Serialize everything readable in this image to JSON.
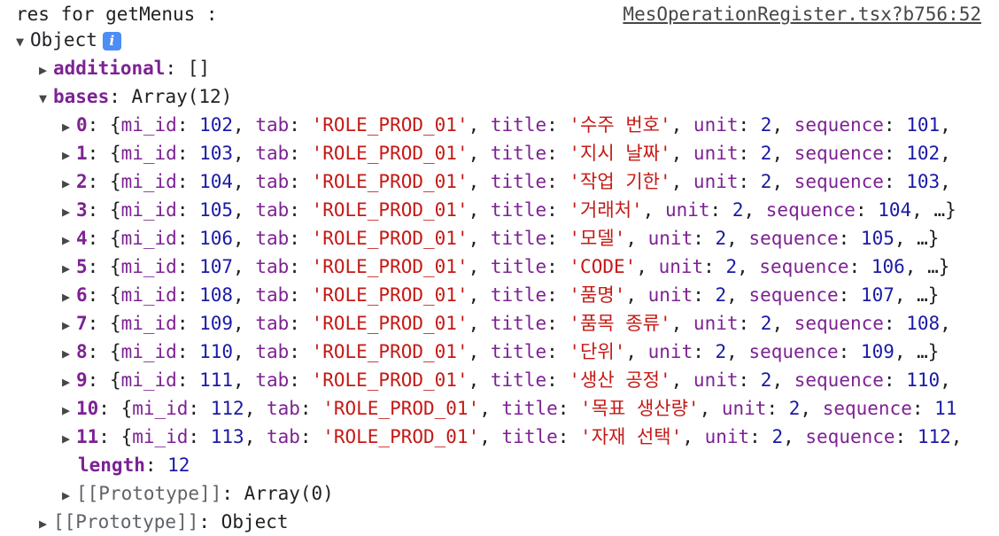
{
  "header": {
    "message": "res for getMenus :",
    "source_link": "MesOperationRegister.tsx?b756:52"
  },
  "root": {
    "label": "Object",
    "info_icon": "i"
  },
  "additional": {
    "key": "additional",
    "value": "[]"
  },
  "bases": {
    "key": "bases",
    "value": "Array(12)",
    "items": [
      {
        "idx": "0",
        "mi_id": "102",
        "tab": "'ROLE_PROD_01'",
        "title": "'수주 번호'",
        "unit": "2",
        "sequence": "101",
        "tail": ","
      },
      {
        "idx": "1",
        "mi_id": "103",
        "tab": "'ROLE_PROD_01'",
        "title": "'지시 날짜'",
        "unit": "2",
        "sequence": "102",
        "tail": ","
      },
      {
        "idx": "2",
        "mi_id": "104",
        "tab": "'ROLE_PROD_01'",
        "title": "'작업 기한'",
        "unit": "2",
        "sequence": "103",
        "tail": ","
      },
      {
        "idx": "3",
        "mi_id": "105",
        "tab": "'ROLE_PROD_01'",
        "title": "'거래처'",
        "unit": "2",
        "sequence": "104",
        "tail": ", …}"
      },
      {
        "idx": "4",
        "mi_id": "106",
        "tab": "'ROLE_PROD_01'",
        "title": "'모델'",
        "unit": "2",
        "sequence": "105",
        "tail": ", …}"
      },
      {
        "idx": "5",
        "mi_id": "107",
        "tab": "'ROLE_PROD_01'",
        "title": "'CODE'",
        "unit": "2",
        "sequence": "106",
        "tail": ", …}"
      },
      {
        "idx": "6",
        "mi_id": "108",
        "tab": "'ROLE_PROD_01'",
        "title": "'품명'",
        "unit": "2",
        "sequence": "107",
        "tail": ", …}"
      },
      {
        "idx": "7",
        "mi_id": "109",
        "tab": "'ROLE_PROD_01'",
        "title": "'품목 종류'",
        "unit": "2",
        "sequence": "108",
        "tail": ","
      },
      {
        "idx": "8",
        "mi_id": "110",
        "tab": "'ROLE_PROD_01'",
        "title": "'단위'",
        "unit": "2",
        "sequence": "109",
        "tail": ", …}"
      },
      {
        "idx": "9",
        "mi_id": "111",
        "tab": "'ROLE_PROD_01'",
        "title": "'생산 공정'",
        "unit": "2",
        "sequence": "110",
        "tail": ","
      },
      {
        "idx": "10",
        "mi_id": "112",
        "tab": "'ROLE_PROD_01'",
        "title": "'목표 생산량'",
        "unit": "2",
        "sequence": "11",
        "tail": ""
      },
      {
        "idx": "11",
        "mi_id": "113",
        "tab": "'ROLE_PROD_01'",
        "title": "'자재 선택'",
        "unit": "2",
        "sequence": "112",
        "tail": ","
      }
    ],
    "length_key": "length",
    "length_value": "12",
    "prototype_key": "[[Prototype]]",
    "prototype_value": "Array(0)"
  },
  "root_prototype": {
    "key": "[[Prototype]]",
    "value": "Object"
  },
  "labels": {
    "mi_id": "mi_id",
    "tab": "tab",
    "title": "title",
    "unit": "unit",
    "sequence": "sequence"
  },
  "icons": {
    "expanded": "expanded-triangle-icon",
    "collapsed": "collapsed-triangle-icon",
    "info": "info-icon"
  },
  "colors": {
    "key": "#7d2293",
    "number": "#1a1aa6",
    "string": "#c41a16",
    "info_badge": "#4c8df6"
  }
}
